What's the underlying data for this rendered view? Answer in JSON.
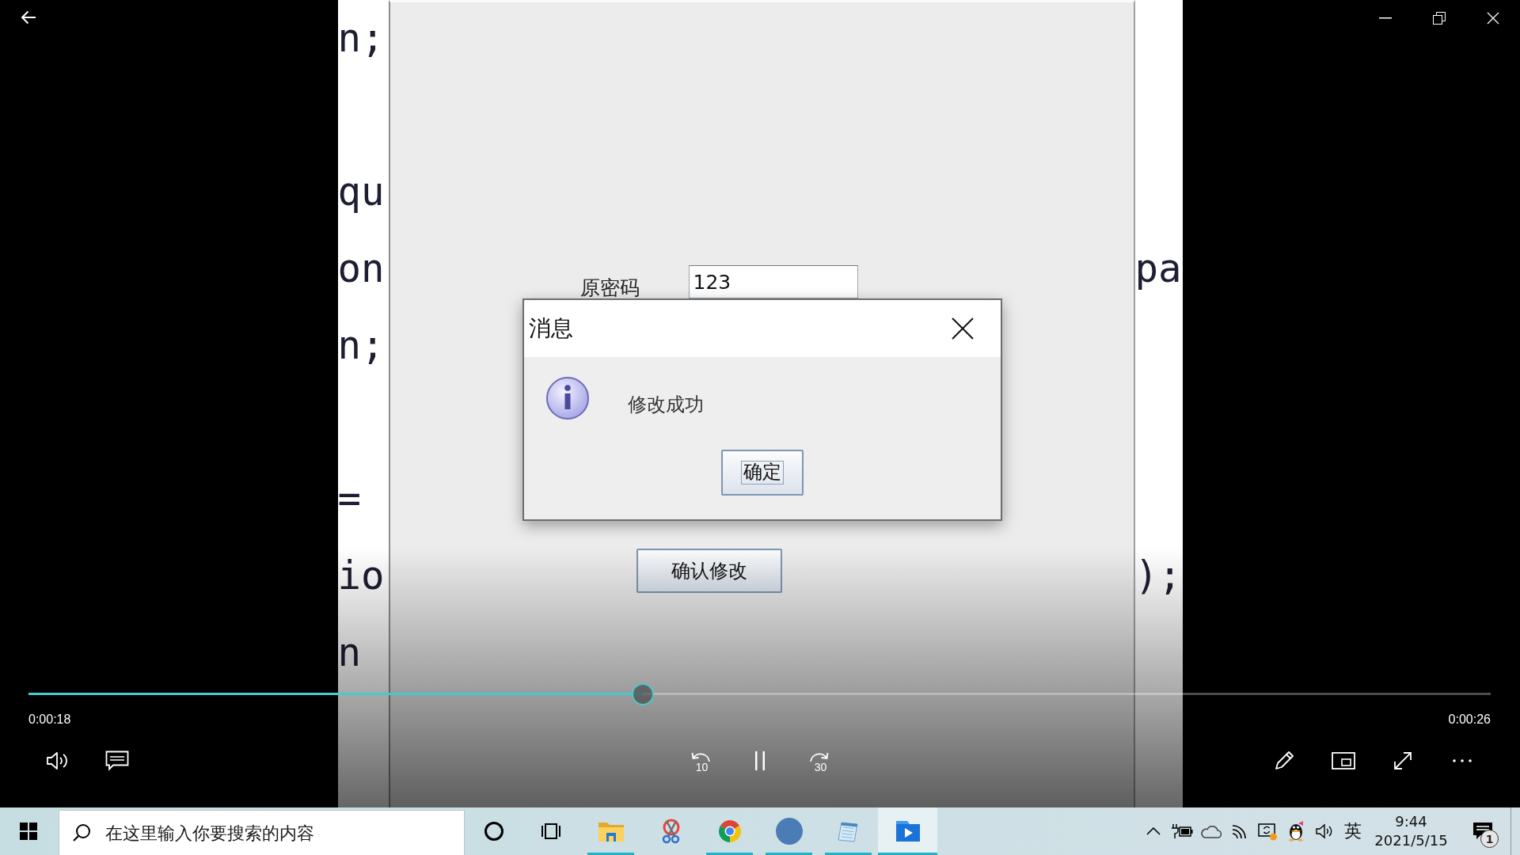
{
  "video_frame": {
    "code_left": [
      [
        "n;"
      ],
      [
        "qu",
        "on",
        "n;"
      ],
      [
        "=",
        "io",
        "n"
      ]
    ],
    "code_right": [
      "pa",
      ");"
    ],
    "app_window": {
      "old_password_label": "原密码",
      "old_password_value": "123",
      "confirm_button": "确认修改"
    },
    "dialog": {
      "title": "消息",
      "message": "修改成功",
      "ok_button": "确定"
    }
  },
  "playback": {
    "level": 0.42,
    "elapsed": "0:00:18",
    "duration": "0:00:26",
    "playing": true,
    "rewind_label": "10",
    "forward_label": "30"
  },
  "taskbar": {
    "search": {
      "placeholder": "在这里输入你要搜索的内容"
    },
    "apps": [
      {
        "kind": "file-explorer",
        "running": true,
        "selected": false
      },
      {
        "kind": "snipping",
        "running": false,
        "selected": false
      },
      {
        "kind": "chrome",
        "running": true,
        "selected": false
      },
      {
        "kind": "avatar",
        "running": true,
        "selected": false
      },
      {
        "kind": "notepad",
        "running": true,
        "selected": false
      },
      {
        "kind": "movies",
        "running": true,
        "selected": true
      }
    ],
    "tray": {
      "input_method": "英",
      "time": "9:44",
      "date": "2021/5/15",
      "notification_count": "1"
    }
  }
}
